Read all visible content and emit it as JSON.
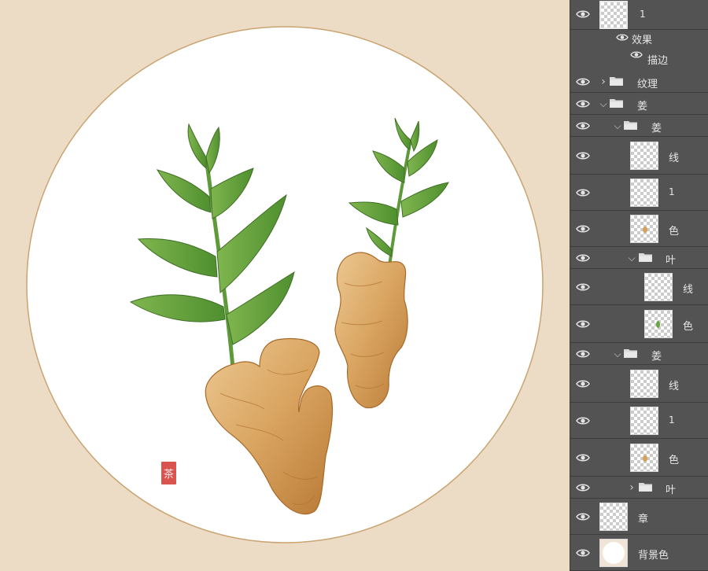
{
  "canvas": {
    "background_color": "#ecdcc6",
    "circle_color": "#ffffff",
    "circle_border_color": "#c9a472",
    "seal_text": "茶",
    "seal_color": "#d9534f"
  },
  "layers_panel": {
    "background_color": "#535353",
    "layers": [
      {
        "id": "top",
        "name": "1",
        "type": "layer",
        "thumb": "checker-selected"
      },
      {
        "id": "effects",
        "name": "效果",
        "type": "effects"
      },
      {
        "id": "stroke",
        "name": "描边",
        "type": "effect"
      },
      {
        "id": "texture",
        "name": "纹理",
        "type": "group",
        "expanded": false
      },
      {
        "id": "ginger-group",
        "name": "姜",
        "type": "group",
        "expanded": true
      },
      {
        "id": "ginger-sub1",
        "name": "姜",
        "type": "group",
        "expanded": true
      },
      {
        "id": "line1",
        "name": "线",
        "type": "layer",
        "thumb": "checker"
      },
      {
        "id": "one1",
        "name": "1",
        "type": "layer",
        "thumb": "checker"
      },
      {
        "id": "color1",
        "name": "色",
        "type": "layer",
        "thumb": "ginger"
      },
      {
        "id": "leaf-group1",
        "name": "叶",
        "type": "group",
        "expanded": true
      },
      {
        "id": "leaf-line",
        "name": "线",
        "type": "layer",
        "thumb": "checker"
      },
      {
        "id": "leaf-color",
        "name": "色",
        "type": "layer",
        "thumb": "leaf"
      },
      {
        "id": "ginger-sub2",
        "name": "姜",
        "type": "group",
        "expanded": true
      },
      {
        "id": "line2",
        "name": "线",
        "type": "layer",
        "thumb": "checker"
      },
      {
        "id": "one2",
        "name": "1",
        "type": "layer",
        "thumb": "checker"
      },
      {
        "id": "color2",
        "name": "色",
        "type": "layer",
        "thumb": "ginger"
      },
      {
        "id": "leaf-group2",
        "name": "叶",
        "type": "group",
        "expanded": false
      },
      {
        "id": "stamp",
        "name": "章",
        "type": "layer",
        "thumb": "checker"
      },
      {
        "id": "bg-color",
        "name": "背景色",
        "type": "layer",
        "thumb": "circle"
      }
    ]
  }
}
